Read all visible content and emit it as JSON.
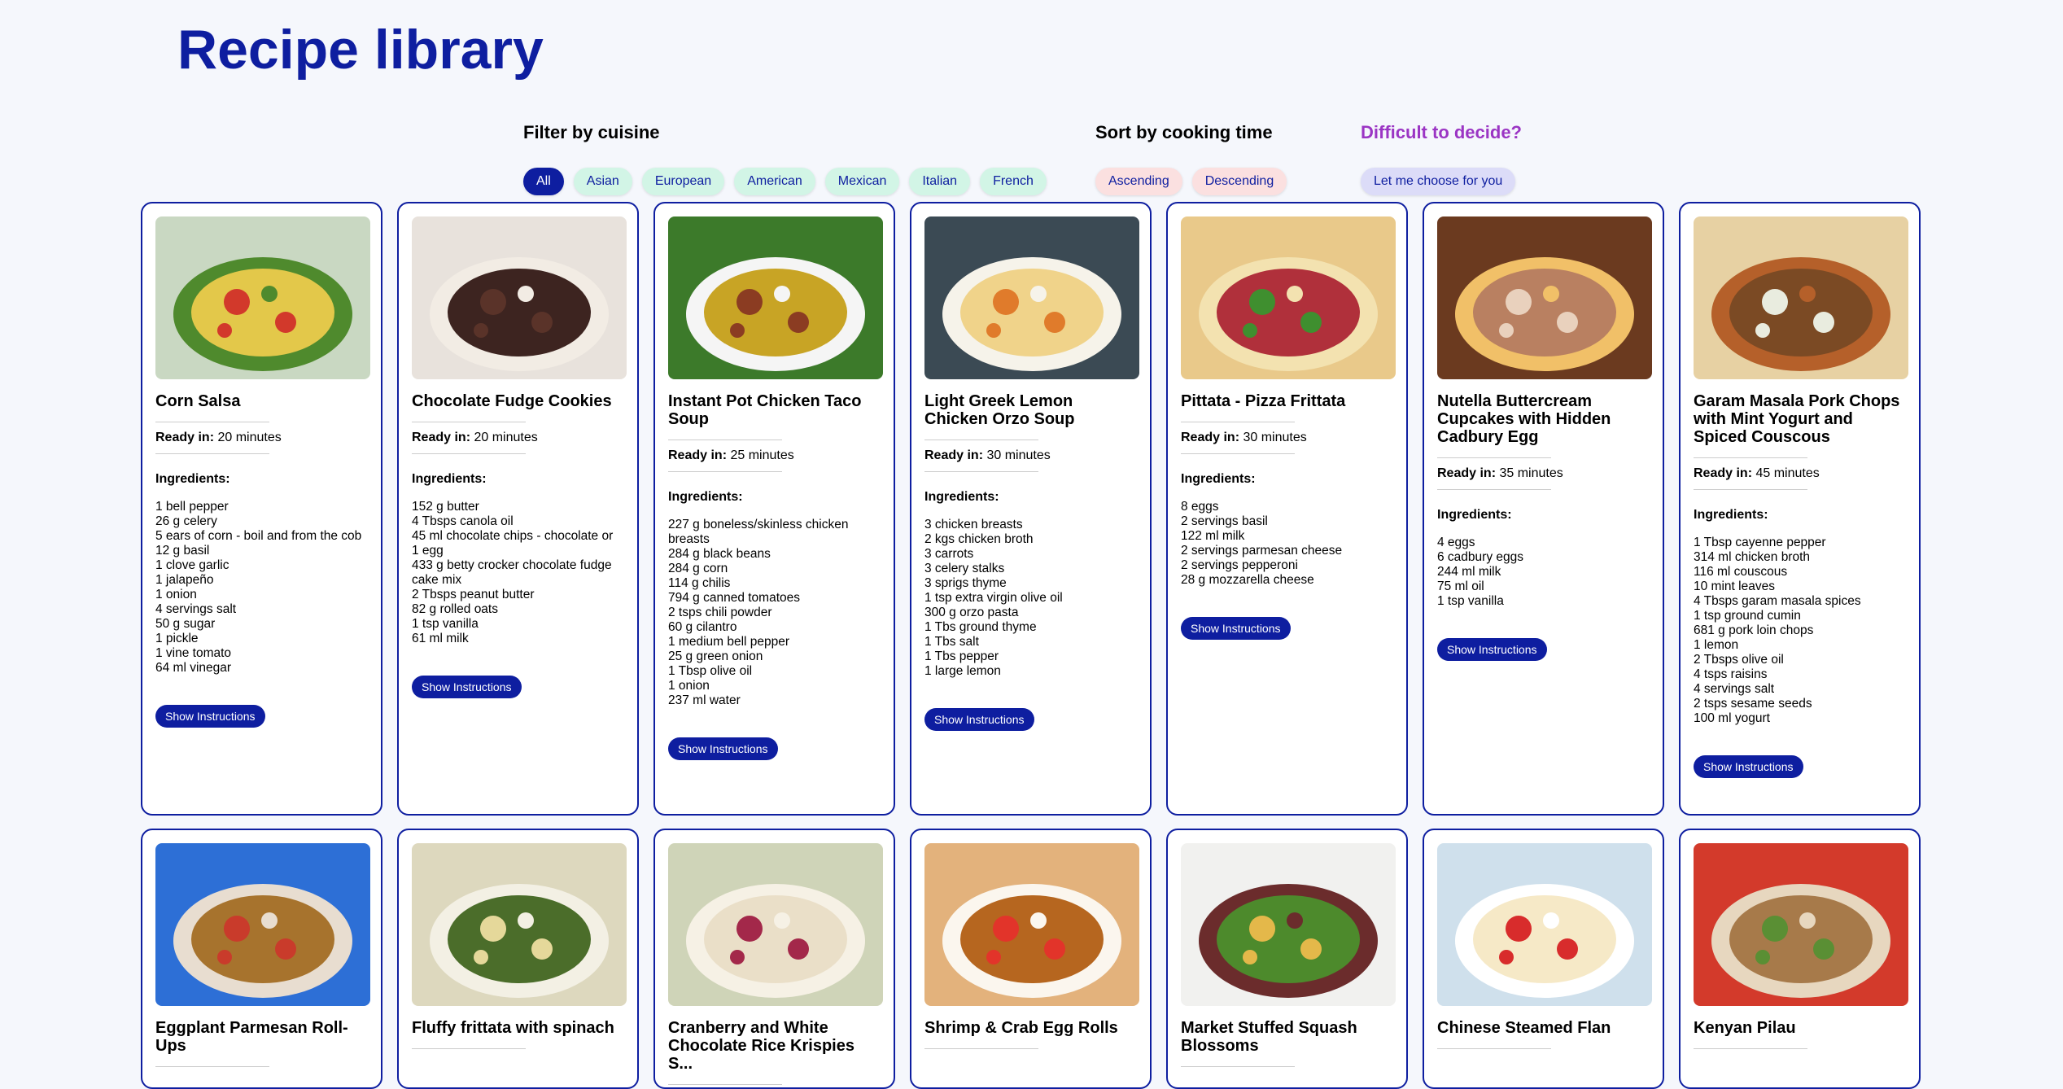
{
  "page_title": "Recipe library",
  "filter": {
    "heading": "Filter by cuisine",
    "options": [
      "All",
      "Asian",
      "European",
      "American",
      "Mexican",
      "Italian",
      "French"
    ],
    "active": "All"
  },
  "sort": {
    "heading": "Sort by cooking time",
    "options": [
      "Ascending",
      "Descending"
    ]
  },
  "decide": {
    "heading": "Difficult to decide?",
    "button": "Let me choose for you"
  },
  "labels": {
    "ready_in": "Ready in:",
    "ingredients": "Ingredients:",
    "show_instructions": "Show Instructions"
  },
  "colors": {
    "accent": "#0e1ea0",
    "cuisine_chip": "#d2f5e6",
    "sort_chip": "#fbe0e0",
    "decide_chip": "#dcdcf8",
    "decide_heading": "#9b35c4"
  },
  "recipes": [
    {
      "title": "Corn Salsa",
      "ready": "20 minutes",
      "image": "corn-salsa-photo",
      "ingredients": [
        "1 bell pepper",
        "26 g celery",
        "5 ears of corn - boil and from the cob",
        "12 g basil",
        "1 clove garlic",
        "1 jalapeño",
        "1 onion",
        "4 servings salt",
        "50 g sugar",
        "1 pickle",
        "1 vine tomato",
        "64 ml vinegar"
      ]
    },
    {
      "title": "Chocolate Fudge Cookies",
      "ready": "20 minutes",
      "image": "chocolate-cookies-photo",
      "ingredients": [
        "152 g butter",
        "4 Tbsps canola oil",
        "45 ml chocolate chips - chocolate or",
        "1 egg",
        "433 g betty crocker chocolate fudge cake mix",
        "2 Tbsps peanut butter",
        "82 g rolled oats",
        "1 tsp vanilla",
        "61 ml milk"
      ]
    },
    {
      "title": "Instant Pot Chicken Taco Soup",
      "ready": "25 minutes",
      "image": "taco-soup-photo",
      "ingredients": [
        "227 g boneless/skinless chicken breasts",
        "284 g black beans",
        "284 g corn",
        "114 g chilis",
        "794 g canned tomatoes",
        "2 tsps chili powder",
        "60 g cilantro",
        "1 medium bell pepper",
        "25 g green onion",
        "1 Tbsp olive oil",
        "1 onion",
        "237 ml water"
      ]
    },
    {
      "title": "Light Greek Lemon Chicken Orzo Soup",
      "ready": "30 minutes",
      "image": "orzo-soup-photo",
      "ingredients": [
        "3 chicken breasts",
        "2 kgs chicken broth",
        "3 carrots",
        "3 celery stalks",
        "3 sprigs thyme",
        "1 tsp extra virgin olive oil",
        "300 g orzo pasta",
        "1 Tbs ground thyme",
        "1 Tbs salt",
        "1 Tbs pepper",
        "1 large lemon"
      ]
    },
    {
      "title": "Pittata - Pizza Frittata",
      "ready": "30 minutes",
      "image": "pizza-frittata-photo",
      "ingredients": [
        "8 eggs",
        "2 servings basil",
        "122 ml milk",
        "2 servings parmesan cheese",
        "2 servings pepperoni",
        "28 g mozzarella cheese"
      ]
    },
    {
      "title": "Nutella Buttercream Cupcakes with Hidden Cadbury Egg",
      "ready": "35 minutes",
      "image": "cupcakes-photo",
      "ingredients": [
        "4 eggs",
        "6 cadbury eggs",
        "244 ml milk",
        "75 ml oil",
        "1 tsp vanilla"
      ]
    },
    {
      "title": "Garam Masala Pork Chops with Mint Yogurt and Spiced Couscous",
      "ready": "45 minutes",
      "image": "pork-chops-photo",
      "ingredients": [
        "1 Tbsp cayenne pepper",
        "314 ml chicken broth",
        "116 ml couscous",
        "10 mint leaves",
        "4 Tbsps garam masala spices",
        "1 tsp ground cumin",
        "681 g pork loin chops",
        "1 lemon",
        "2 Tbsps olive oil",
        "4 tsps raisins",
        "4 servings salt",
        "2 tsps sesame seeds",
        "100 ml yogurt"
      ]
    },
    {
      "title": "Eggplant Parmesan Roll-Ups",
      "image": "eggplant-photo"
    },
    {
      "title": "Fluffy frittata with spinach",
      "image": "spinach-frittata-photo"
    },
    {
      "title": "Cranberry and White Chocolate Rice Krispies S...",
      "image": "rice-krispies-photo"
    },
    {
      "title": "Shrimp & Crab Egg Rolls",
      "image": "egg-rolls-photo"
    },
    {
      "title": "Market Stuffed Squash Blossoms",
      "image": "squash-blossoms-photo"
    },
    {
      "title": "Chinese Steamed Flan",
      "image": "flan-photo"
    },
    {
      "title": "Kenyan Pilau",
      "image": "pilau-photo"
    }
  ]
}
